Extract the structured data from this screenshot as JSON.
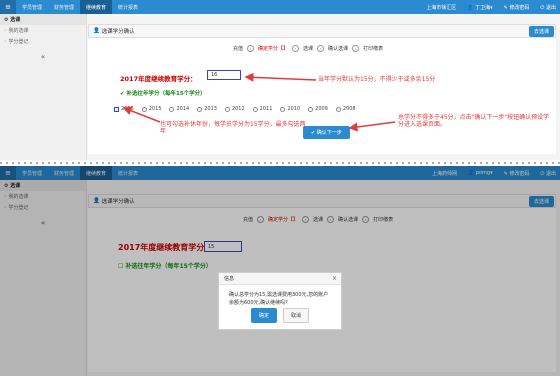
{
  "top": {
    "nav": [
      "学员管理",
      "财务管理",
      "继续教育",
      "统计报表"
    ],
    "active_nav_index": 2,
    "user_top": "上海市徐汇区",
    "user_name": "丁卫海",
    "change_pwd": "修改密码",
    "logout": "退出",
    "user_bottom": "上海药师网",
    "user_name_bottom": "pomg"
  },
  "sidebar": {
    "section": "选课",
    "items": [
      "我的选课",
      "学分登记"
    ],
    "collapse": "«"
  },
  "panel": {
    "title": "选课学分确认",
    "action_button": "去选课"
  },
  "steps": {
    "first": "充值",
    "current": "确定学分【】",
    "s3": "选课",
    "s4": "确认选课",
    "s5": "打印缴表"
  },
  "form": {
    "year_title": "2017年度继续教育学分：",
    "credit_value": "16",
    "credit_value_bottom": "15",
    "makeup_label": "补选往年学分（每年15个学分）",
    "years": [
      "2016",
      "2015",
      "2014",
      "2013",
      "2012",
      "2011",
      "2010",
      "2009",
      "2008"
    ],
    "confirm_button": "确认下一步"
  },
  "annotations": {
    "a1": "当年学分默认为15分，不得少于或多余15分",
    "a2": "总学分不得多于45分，点击\"确认下一步\"按钮确认预设学分进入选课页面。",
    "a3": "也可勾选补休年份，每学员学分为15学分，最多勾选两年"
  },
  "modal": {
    "title": "信息",
    "close": "×",
    "body": "确认总学分为15,需选课费用300元,您的账户余额为600元,确认继续吗？",
    "ok": "确定",
    "cancel": "取消"
  },
  "icons": {
    "brand": "menu-icon",
    "user": "user-icon",
    "pen": "edit-icon",
    "power": "logout-icon"
  },
  "colors": {
    "accent": "#2b8bd0",
    "annotation": "#e23b3b",
    "title_red": "#c00000",
    "green": "#1a8a1a"
  }
}
